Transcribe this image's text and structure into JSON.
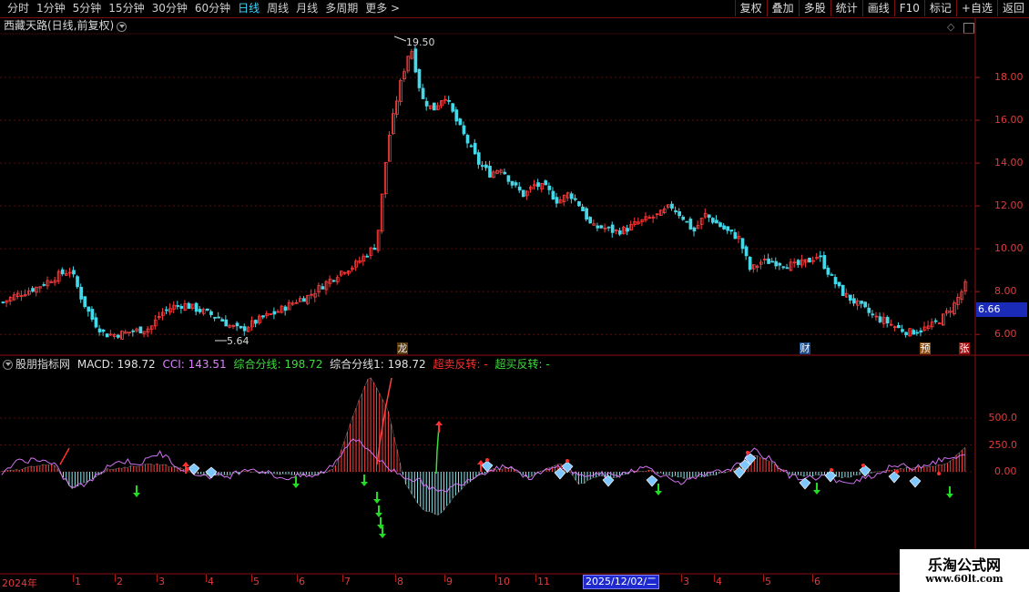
{
  "toolbar": {
    "periods": [
      "分时",
      "1分钟",
      "5分钟",
      "15分钟",
      "30分钟",
      "60分钟",
      "日线",
      "周线",
      "月线",
      "多周期",
      "更多 >"
    ],
    "active_period": "日线",
    "buttons": [
      "复权",
      "叠加",
      "多股",
      "统计",
      "画线",
      "F10",
      "标记",
      "+自选",
      "返回"
    ]
  },
  "main_panel": {
    "title": "西藏天路(日线,前复权)",
    "high_label": "19.50",
    "low_label": "5.64",
    "current_price": "6.66",
    "event_tags": [
      {
        "text": "龙",
        "color": "#e8e8e8",
        "bg": "#5a3b10"
      },
      {
        "text": "财",
        "color": "#ffffff",
        "bg": "#1b4a8a"
      },
      {
        "text": "预",
        "color": "#ffffff",
        "bg": "#8a4a10"
      },
      {
        "text": "张",
        "color": "#ffffff",
        "bg": "#a01010"
      }
    ],
    "y_labels": [
      "18.00",
      "16.00",
      "14.00",
      "12.00",
      "10.00",
      "8.00",
      "6.00"
    ]
  },
  "indicator_panel": {
    "name": "股朋指标网",
    "macd_label": "MACD: 198.72",
    "cci_label": "CCI: 143.51",
    "line1_label": "综合分线: 198.72",
    "line2_label": "综合分线1: 198.72",
    "oversell_label": "超卖反转: -",
    "overbuy_label": "超买反转: -",
    "y_labels": [
      "500.0",
      "250.0",
      "0.00"
    ],
    "colors": {
      "macd": "#e0e0e0",
      "cci": "#e080ff",
      "line1": "#3ddc3d",
      "line2": "#e0e0e0",
      "oversell": "#ff3030",
      "overbuy": "#3ddc3d"
    }
  },
  "time_axis": {
    "year_label": "2024年",
    "months": [
      "1",
      "2",
      "3",
      "4",
      "5",
      "6",
      "7",
      "8",
      "9",
      "10",
      "11",
      "3",
      "4",
      "5",
      "6"
    ],
    "cursor_date": "2025/12/02/二"
  },
  "chart_data": {
    "type": "candlestick",
    "title": "西藏天路(日线,前复权)",
    "price_range": [
      5.2,
      20.0
    ],
    "max_marked": 19.5,
    "min_marked": 5.64,
    "last_price": 6.66,
    "closes": [
      7.5,
      7.8,
      8.0,
      8.2,
      8.5,
      8.8,
      9.0,
      7.6,
      6.6,
      6.0,
      6.0,
      6.1,
      6.2,
      6.3,
      7.0,
      7.3,
      7.4,
      7.2,
      7.0,
      6.8,
      6.4,
      6.2,
      6.5,
      6.8,
      7.0,
      7.3,
      7.6,
      7.8,
      8.2,
      8.6,
      9.0,
      9.2,
      9.7,
      10.2,
      15.0,
      17.5,
      19.5,
      17.0,
      16.5,
      17.2,
      16.0,
      15.0,
      14.0,
      13.5,
      13.8,
      13.0,
      12.5,
      13.0,
      12.8,
      12.2,
      12.6,
      12.0,
      11.0,
      11.0,
      10.8,
      10.9,
      11.2,
      11.4,
      11.6,
      12.0,
      11.5,
      10.8,
      11.6,
      11.2,
      10.8,
      10.5,
      9.0,
      9.4,
      9.4,
      9.3,
      9.2,
      9.4,
      9.7,
      8.8,
      8.0,
      7.6,
      7.2,
      6.8,
      6.6,
      6.3,
      6.1,
      6.2,
      6.4,
      6.8,
      7.4,
      8.3
    ],
    "osc_series": [
      {
        "name": "MACD",
        "values": [
          0,
          20,
          60,
          60,
          -150,
          -80,
          20,
          40,
          60,
          70,
          40,
          -10,
          -40,
          -20,
          0,
          -10,
          -20,
          -30,
          -20,
          20,
          500,
          900,
          600,
          -100,
          -350,
          -400,
          -200,
          -50,
          20,
          40,
          -60,
          20,
          80,
          -120,
          -40,
          -50,
          0,
          10,
          -30,
          -60,
          -40,
          -20,
          40,
          160,
          80,
          -20,
          -40,
          -30,
          -60,
          -20,
          0,
          20,
          40,
          50,
          80,
          220
        ]
      },
      {
        "name": "CCI",
        "values": [
          0,
          100,
          120,
          60,
          -150,
          -100,
          60,
          100,
          80,
          180,
          60,
          -20,
          -40,
          -40,
          40,
          0,
          -60,
          -40,
          -40,
          80,
          320,
          200,
          40,
          -40,
          -100,
          -200,
          -120,
          -40,
          30,
          60,
          -60,
          0,
          60,
          -40,
          -20,
          -40,
          20,
          40,
          -60,
          -100,
          -40,
          0,
          60,
          200,
          100,
          -40,
          -60,
          -40,
          -120,
          -60,
          -20,
          60,
          40,
          80,
          120,
          140
        ]
      }
    ]
  }
}
